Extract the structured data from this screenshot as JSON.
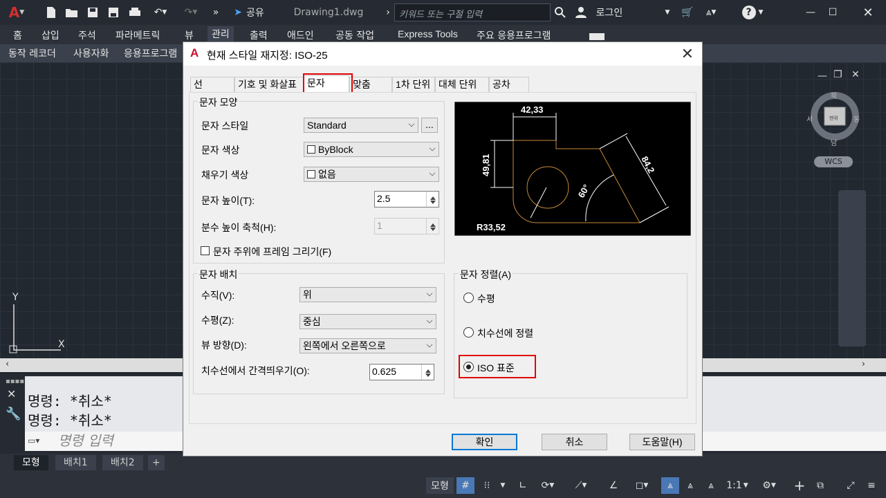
{
  "titlebar": {
    "share": "공유",
    "document": "Drawing1.dwg",
    "search_placeholder": "키워드 또는 구절 입력",
    "login": "로그인"
  },
  "ribbon_tabs": [
    "홈",
    "삽입",
    "주석",
    "파라메트릭",
    "뷰",
    "관리",
    "출력",
    "애드인",
    "공동 작업",
    "Express Tools",
    "주요 응용프로그램"
  ],
  "panels": [
    "동작 레코더",
    "사용자화",
    "응용프로그램"
  ],
  "viewcube": {
    "north": "북",
    "west": "서",
    "east": "동",
    "south": "남",
    "center": "맨위",
    "wcs": "WCS"
  },
  "command": {
    "history": [
      "명령: *취소*",
      "명령: *취소*"
    ],
    "placeholder": "명령 입력"
  },
  "layout_tabs": [
    "모형",
    "배치1",
    "배치2",
    "+"
  ],
  "status": {
    "model": "모형",
    "scale": "1:1"
  },
  "dialog": {
    "title": "현재 스타일 재지정: ISO-25",
    "tabs": [
      "선",
      "기호 및 화살표",
      "문자",
      "맞춤",
      "1차 단위",
      "대체 단위",
      "공차"
    ],
    "active_tab": "문자",
    "appearance": {
      "group": "문자 모양",
      "style_label": "문자 스타일",
      "style_value": "Standard",
      "browse": "...",
      "color_label": "문자 색상",
      "color_value": "ByBlock",
      "fill_label": "채우기 색상",
      "fill_value": "없음",
      "height_label": "문자 높이(T):",
      "height_value": "2.5",
      "fraction_label": "분수 높이 축척(H):",
      "fraction_value": "1",
      "frame_label": "문자 주위에 프레임 그리기(F)"
    },
    "placement": {
      "group": "문자 배치",
      "vertical_label": "수직(V):",
      "vertical_value": "위",
      "horizontal_label": "수평(Z):",
      "horizontal_value": "중심",
      "view_label": "뷰 방향(D):",
      "view_value": "왼쪽에서 오른쪽으로",
      "offset_label": "치수선에서 간격띄우기(O):",
      "offset_value": "0.625"
    },
    "alignment": {
      "group": "문자 정렬(A)",
      "options": [
        "수평",
        "치수선에 정렬",
        "ISO 표준"
      ],
      "selected": "ISO 표준"
    },
    "preview": {
      "dim1": "42,33",
      "dim2": "49,81",
      "dim3": "84,2",
      "angle": "60°",
      "radius": "R33,52"
    },
    "buttons": {
      "ok": "확인",
      "cancel": "취소",
      "help": "도움말(H)"
    }
  },
  "colors": {
    "accent_red": "#e00000",
    "autocad_red": "#c8102e",
    "dialog_bg": "#f0f0f0"
  }
}
